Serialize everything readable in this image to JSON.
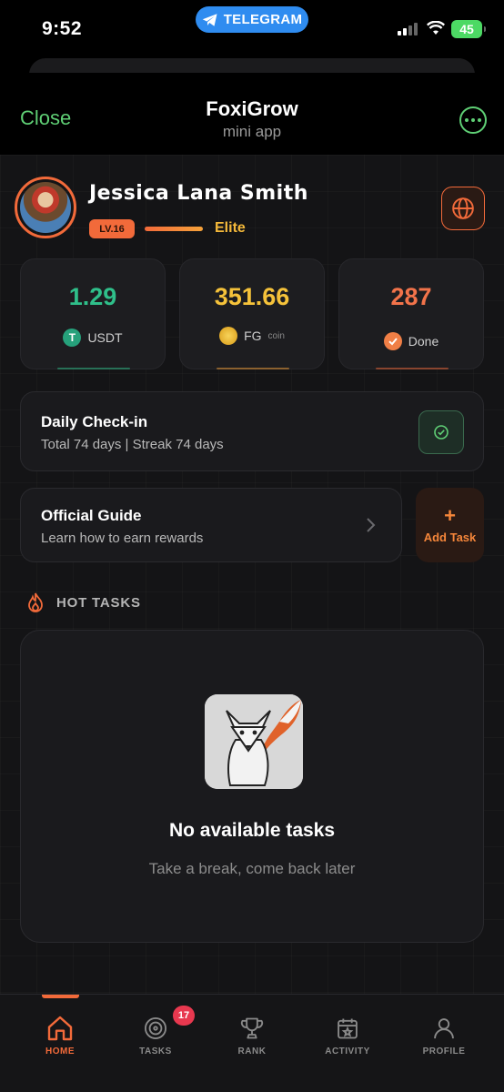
{
  "status_bar": {
    "time": "9:52",
    "telegram_label": "TELEGRAM",
    "battery": "45"
  },
  "header": {
    "close_label": "Close",
    "title": "FoxiGrow",
    "subtitle": "mini app"
  },
  "profile": {
    "name": "Jessica Lana Smith",
    "level": "LV.16",
    "tier": "Elite"
  },
  "stats": [
    {
      "value": "1.29",
      "label": "USDT",
      "color": "#2fbf8a"
    },
    {
      "value": "351.66",
      "label": "FG",
      "sublabel": "coin",
      "color": "#f5c23a"
    },
    {
      "value": "287",
      "label": "Done",
      "color": "#f2734a"
    }
  ],
  "checkin": {
    "title": "Daily Check-in",
    "subtitle": "Total 74 days | Streak 74 days"
  },
  "guide": {
    "title": "Official Guide",
    "subtitle": "Learn how to earn rewards"
  },
  "add_task": {
    "icon": "+",
    "label": "Add Task"
  },
  "hot_tasks": {
    "heading": "HOT TASKS",
    "empty_title": "No available tasks",
    "empty_subtitle": "Take a break, come back later"
  },
  "nav": {
    "items": [
      {
        "label": "HOME",
        "icon": "home-icon",
        "active": true
      },
      {
        "label": "TASKS",
        "icon": "target-icon",
        "badge": "17"
      },
      {
        "label": "RANK",
        "icon": "trophy-icon"
      },
      {
        "label": "ACTIVITY",
        "icon": "calendar-icon"
      },
      {
        "label": "PROFILE",
        "icon": "user-icon"
      }
    ]
  },
  "colors": {
    "accent": "#f26a3a",
    "telegram_green": "#5fcf75",
    "telegram_blue": "#2f8cf0"
  }
}
